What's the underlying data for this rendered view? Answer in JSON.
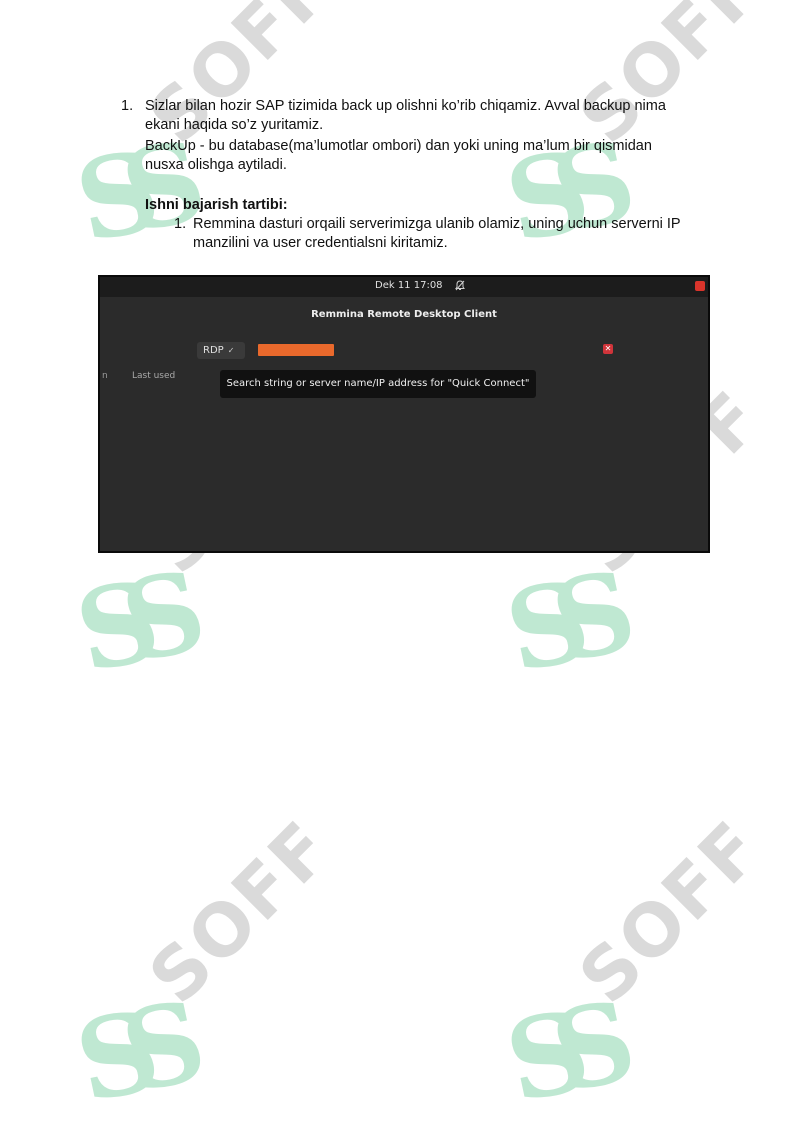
{
  "document": {
    "item1_number": "1.",
    "item1_text": "Sizlar bilan hozir SAP tizimida back up olishni ko’rib chiqamiz. Avval backup nima ekani haqida so’z yuritamiz.",
    "backup_definition": "BackUp  - bu database(ma’lumotlar ombori) dan yoki uning ma’lum bir qismidan nusxa olishga aytiladi.",
    "heading": "Ishni bajarish tartibi:",
    "step1_number": "1.",
    "step1_text": "Remmina dasturi orqaili serverimizga ulanib olamiz, uning uchun serverni IP manzilini va user credentialsni kiritamiz."
  },
  "watermark": {
    "logo_text": "SOFF",
    "colors": {
      "mark": "#bfe8d2",
      "text": "#dadada"
    }
  },
  "screenshot": {
    "topbar": {
      "clock": "Dek 11  17:08",
      "notification_icon": "bell-off-icon",
      "power_icon": "power-icon"
    },
    "app_title": "Remmina Remote Desktop Client",
    "protocol_select": {
      "value": "RDP",
      "chevron": "✓"
    },
    "address_field": {
      "highlight_color": "#e9692c"
    },
    "clear_icon": "✕",
    "columns": {
      "name_fragment": "n",
      "last_used": "Last used"
    },
    "tooltip": "Search string or server name/IP address for \"Quick Connect\""
  }
}
